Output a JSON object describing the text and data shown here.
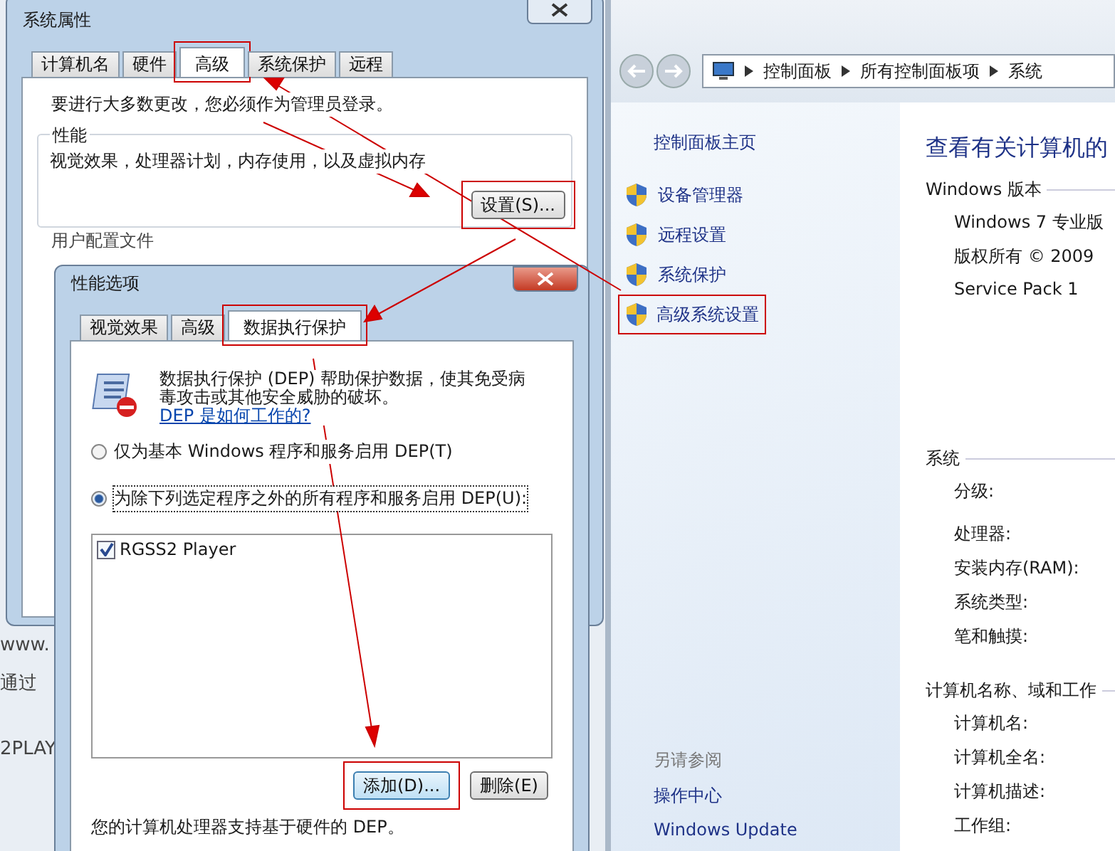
{
  "background_page": {
    "fragments": [
      "www.",
      "通过",
      "2PLAY"
    ]
  },
  "control_panel": {
    "breadcrumb": [
      "控制面板",
      "所有控制面板项",
      "系统"
    ],
    "sidebar": {
      "home": "控制面板主页",
      "items": [
        {
          "label": "设备管理器",
          "highlighted": false
        },
        {
          "label": "远程设置",
          "highlighted": false
        },
        {
          "label": "系统保护",
          "highlighted": false
        },
        {
          "label": "高级系统设置",
          "highlighted": true
        }
      ],
      "see_also_title": "另请参阅",
      "see_also": [
        "操作中心",
        "Windows Update"
      ]
    },
    "main": {
      "title": "查看有关计算机的",
      "sections": [
        {
          "heading": "Windows 版本",
          "rows": [
            "Windows 7 专业版",
            "版权所有 © 2009",
            "Service Pack 1"
          ]
        },
        {
          "heading": "系统",
          "rows": [
            "分级:",
            "处理器:",
            "安装内存(RAM):",
            "系统类型:",
            "笔和触摸:"
          ]
        },
        {
          "heading": "计算机名称、域和工作",
          "rows": [
            "计算机名:",
            "计算机全名:",
            "计算机描述:",
            "工作组:"
          ]
        }
      ]
    }
  },
  "system_properties": {
    "title": "系统属性",
    "tabs": [
      {
        "label": "计算机名",
        "selected": false,
        "highlighted": false
      },
      {
        "label": "硬件",
        "selected": false,
        "highlighted": false
      },
      {
        "label": "高级",
        "selected": true,
        "highlighted": true
      },
      {
        "label": "系统保护",
        "selected": false,
        "highlighted": false
      },
      {
        "label": "远程",
        "selected": false,
        "highlighted": false
      }
    ],
    "notice": "要进行大多数更改，您必须作为管理员登录。",
    "performance": {
      "legend": "性能",
      "description": "视觉效果，处理器计划，内存使用，以及虚拟内存",
      "button": {
        "label": "设置(S)...",
        "highlighted": true
      }
    },
    "user_profiles_legend": "用户配置文件"
  },
  "performance_options": {
    "title": "性能选项",
    "tabs": [
      {
        "label": "视觉效果",
        "selected": false,
        "highlighted": false
      },
      {
        "label": "高级",
        "selected": false,
        "highlighted": false
      },
      {
        "label": "数据执行保护",
        "selected": true,
        "highlighted": true
      }
    ],
    "description": "数据执行保护 (DEP) 帮助保护数据，使其免受病毒攻击或其他安全威胁的破坏。",
    "link": "DEP 是如何工作的?",
    "options": [
      {
        "label": "仅为基本 Windows 程序和服务启用 DEP(T)",
        "selected": false
      },
      {
        "label": "为除下列选定程序之外的所有程序和服务启用 DEP(U):",
        "selected": true
      }
    ],
    "exceptions": [
      {
        "label": "RGSS2 Player",
        "checked": true
      }
    ],
    "buttons": [
      {
        "label": "添加(D)...",
        "highlighted": true,
        "default": true
      },
      {
        "label": "删除(E)",
        "highlighted": false,
        "default": false
      }
    ],
    "footer": "您的计算机处理器支持基于硬件的 DEP。"
  }
}
